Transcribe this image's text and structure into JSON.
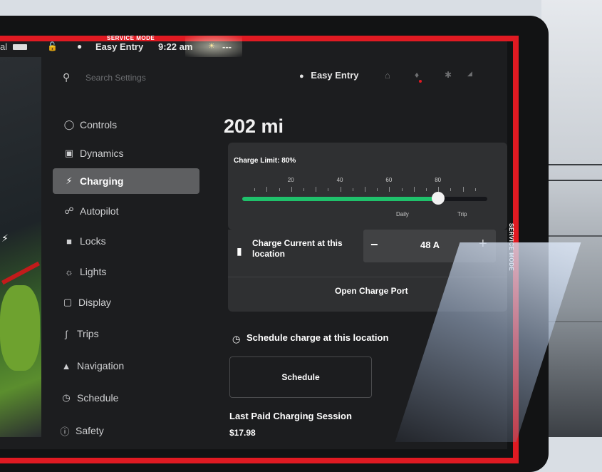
{
  "service_mode": {
    "top_label": "SERVICE MODE",
    "side_label": "SERVICE MODE"
  },
  "statusbar": {
    "profile": "Easy Entry",
    "time": "9:22 am",
    "temp": "---"
  },
  "header": {
    "search_placeholder": "Search Settings",
    "profile": "Easy Entry"
  },
  "sidebar": {
    "items": [
      {
        "label": "Controls",
        "icon": "toggle-icon"
      },
      {
        "label": "Dynamics",
        "icon": "car-icon"
      },
      {
        "label": "Charging",
        "icon": "bolt-icon",
        "active": true
      },
      {
        "label": "Autopilot",
        "icon": "steering-wheel-icon"
      },
      {
        "label": "Locks",
        "icon": "lock-icon"
      },
      {
        "label": "Lights",
        "icon": "sun-icon"
      },
      {
        "label": "Display",
        "icon": "display-icon"
      },
      {
        "label": "Trips",
        "icon": "trips-icon"
      },
      {
        "label": "Navigation",
        "icon": "navigation-icon"
      },
      {
        "label": "Schedule",
        "icon": "clock-icon"
      },
      {
        "label": "Safety",
        "icon": "safety-icon"
      }
    ]
  },
  "charging": {
    "range": "202 mi",
    "limit_label": "Charge Limit: 80%",
    "limit_percent": 80,
    "ticks": [
      "20",
      "40",
      "60",
      "80"
    ],
    "daily_label": "Daily",
    "trip_label": "Trip",
    "current_label": "Charge Current at this location",
    "current_value": "48 A",
    "minus": "−",
    "plus": "+",
    "open_port": "Open Charge Port",
    "schedule_heading": "Schedule charge at this location",
    "schedule_button": "Schedule",
    "last_session_heading": "Last Paid Charging Session",
    "last_session_amount": "$17.98"
  },
  "colors": {
    "accent_green": "#1fc16b",
    "service_red": "#e01a22"
  }
}
